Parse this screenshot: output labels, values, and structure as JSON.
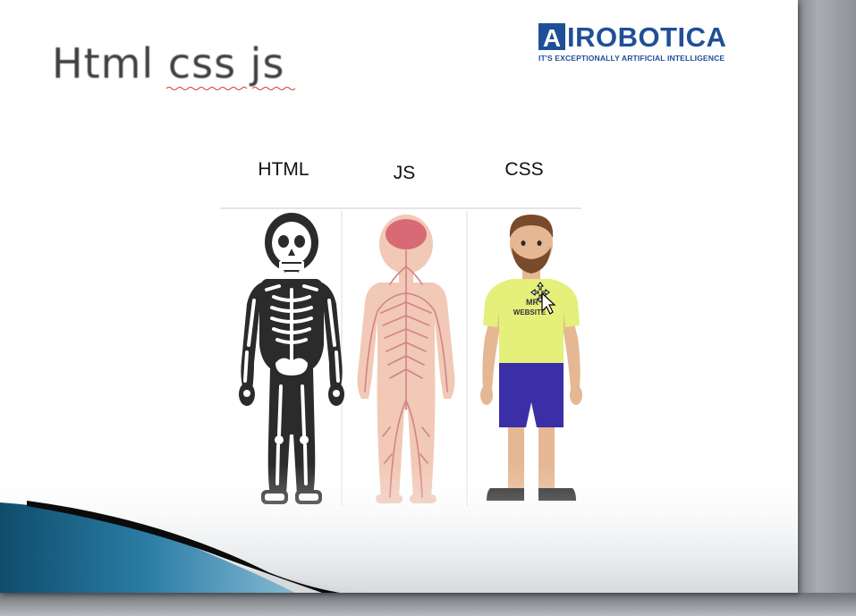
{
  "slide": {
    "title": "Html css js",
    "logo": {
      "mark_letter": "A",
      "wordmark": "IROBOTICA",
      "tagline": "IT'S EXCEPTIONALLY ARTIFICIAL INTELLIGENCE"
    },
    "columns": [
      {
        "label": "HTML",
        "figure": "skeleton-figure"
      },
      {
        "label": "JS",
        "figure": "nervous-system-figure"
      },
      {
        "label": "CSS",
        "figure": "dressed-man-figure"
      }
    ],
    "shirt_text": [
      "MR",
      "WEBSITE"
    ]
  },
  "colors": {
    "brand": "#1f4f96",
    "title_text": "#404040",
    "shirt": "#e4f07a",
    "shorts": "#3a2fa6",
    "swoosh_dark": "#0f4c6b",
    "swoosh_light": "#2b7da6"
  }
}
